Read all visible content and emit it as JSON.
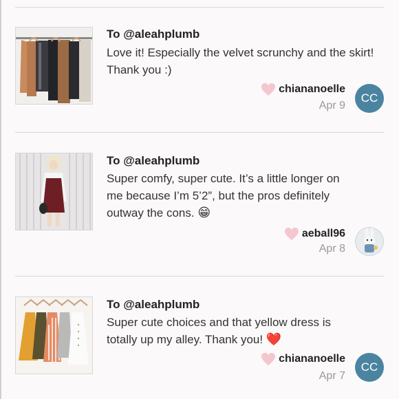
{
  "reviews": [
    {
      "to": "To @aleahplumb",
      "comment": "Love it! Especially the velvet scrunchy and the skirt! Thank you :)",
      "username": "chiananoelle",
      "date": "Apr 9",
      "avatar_initials": "CC",
      "avatar_color": "#4b84a1",
      "icon": "heart-icon",
      "heart_color": "#f6c6cf",
      "thumb_subject": "clothing-rack-photo"
    },
    {
      "to": "To @aleahplumb",
      "comment_lines": [
        "Super comfy, super cute. It’s a little longer on",
        "me because I’m 5’2”, but the pros definitely",
        "outway the cons. "
      ],
      "emoji": "😁",
      "username": "aeball96",
      "date": "Apr 8",
      "icon": "heart-icon",
      "heart_color": "#f6c6cf",
      "thumb_subject": "person-wearing-dress-photo"
    },
    {
      "to": "To @aleahplumb",
      "comment_lines": [
        "Super cute choices and that yellow dress is",
        "totally up my alley. Thank you! "
      ],
      "emoji": "❤️",
      "username": "chiananoelle",
      "date": "Apr 7",
      "avatar_initials": "CC",
      "avatar_color": "#4b84a1",
      "icon": "heart-icon",
      "heart_color": "#f6c6cf",
      "thumb_subject": "dresses-on-hangers-photo"
    }
  ]
}
